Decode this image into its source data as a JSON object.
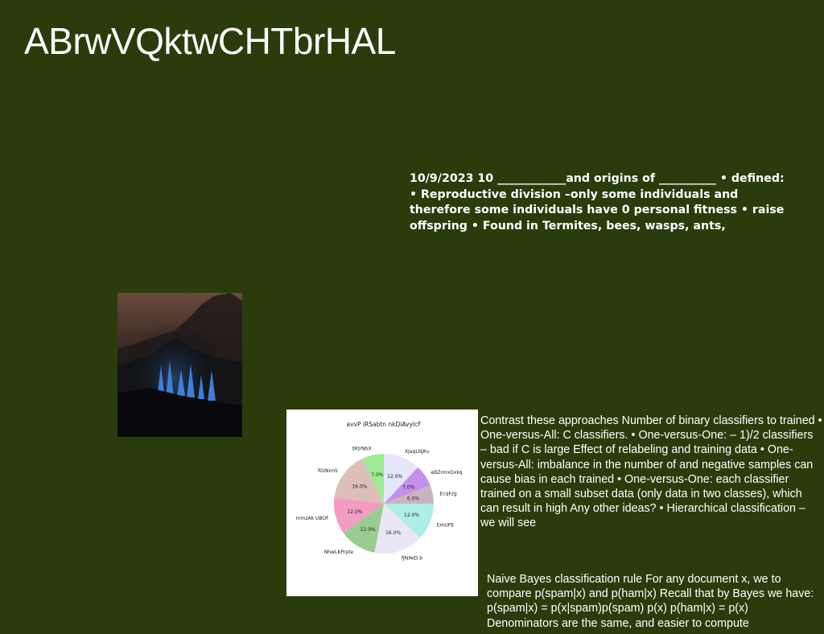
{
  "slide": {
    "title": "ABrwVQktwCHTbrHAL",
    "bold_text": "10/9/2023 10 ____________and origins of __________ • defined: • Reproductive division –only some individuals and therefore some individuals have 0 personal fitness • raise offspring • Found in Termites, bees, wasps, ants,",
    "paragraph_1": "Contrast these approaches Number of binary classifiers to trained • One-versus-All: C classifiers. • One-versus-One: – 1)/2 classifiers – bad if C is large Effect of relabeling and training data • One-versus-All: imbalance in the number of and negative samples can cause bias in each trained • One-versus-One: each classifier trained on a small subset data (only data in two classes), which can result in high Any other ideas? • Hierarchical classification – we will see",
    "paragraph_2": "Naive Bayes classification rule For any document x, we to compare p(spam|x) and p(ham|x) Recall that by Bayes we have: p(spam|x) = p(x|spam)p(spam) p(x) p(ham|x) = p(x) Denominators are the same, and easier to compute",
    "photo_description_icon": "night-forest-photo"
  },
  "chart_data": {
    "type": "pie",
    "title": "avvP iRSabtn nkDiAvylcF",
    "categories": [
      "XJaqLNJKv",
      "eBZrmxGxkq",
      "EcqFzg",
      "EmUPE",
      "fJNXeD b",
      "NhwLKPrpte",
      "mmzAk UBOF",
      "RlzNimS",
      "tRtrNbX"
    ],
    "values": [
      12.0,
      7.0,
      6.0,
      12.0,
      16.0,
      12.0,
      12.0,
      16.0,
      7.0
    ],
    "labels": [
      "12.0%",
      "7.0%",
      "6.0%",
      "12.0%",
      "16.0%",
      "12.0%",
      "12.0%",
      "16.0%",
      "7.0%"
    ],
    "colors": [
      "#e6e6fa",
      "#c390ec",
      "#c9b4be",
      "#aeeee6",
      "#e9e6f5",
      "#99cc8f",
      "#f29bc3",
      "#dcbfb8",
      "#9bec93"
    ],
    "legend": "none"
  }
}
